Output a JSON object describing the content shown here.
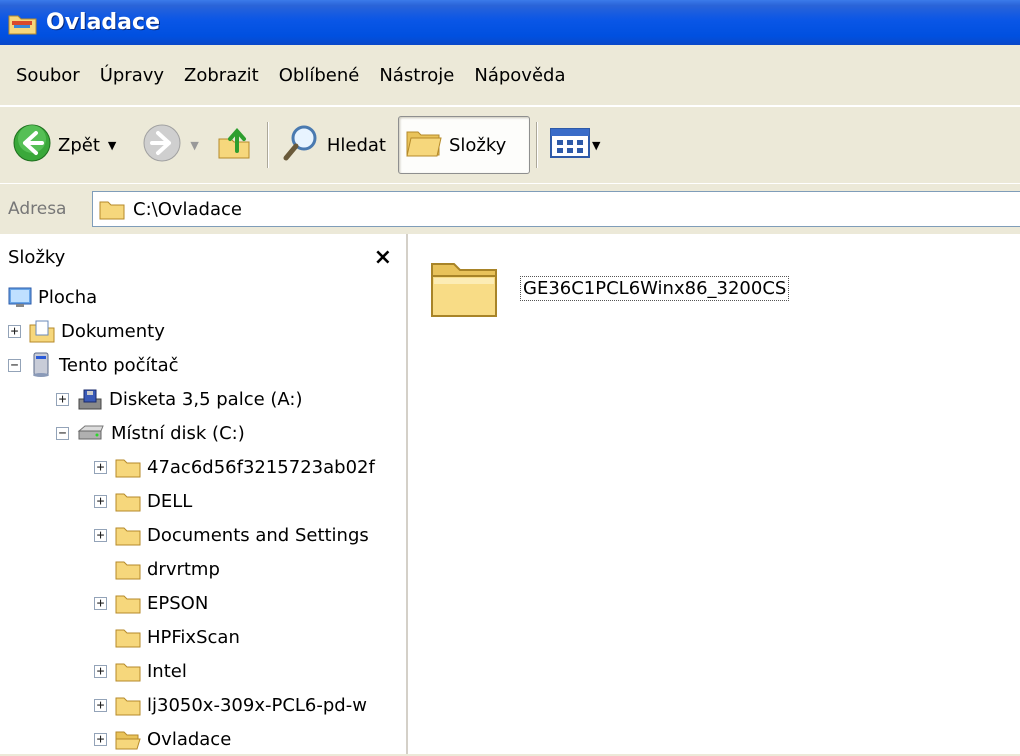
{
  "window": {
    "title": "Ovladace"
  },
  "menu": [
    "Soubor",
    "Úpravy",
    "Zobrazit",
    "Oblíbené",
    "Nástroje",
    "Nápověda"
  ],
  "toolbar": {
    "back_label": "Zpět",
    "search_label": "Hledat",
    "folders_label": "Složky"
  },
  "address": {
    "label": "Adresa",
    "value": "C:\\Ovladace"
  },
  "folder_pane": {
    "title": "Složky",
    "close_glyph": "×",
    "tree": [
      {
        "label": "Plocha",
        "level": 0,
        "expander": "",
        "icon": "desktop-icon"
      },
      {
        "label": "Dokumenty",
        "level": 1,
        "expander": "+",
        "icon": "documents-folder-icon"
      },
      {
        "label": "Tento počítač",
        "level": 1,
        "expander": "−",
        "icon": "computer-icon"
      },
      {
        "label": "Disketa 3,5 palce (A:)",
        "level": 2,
        "expander": "+",
        "icon": "floppy-icon"
      },
      {
        "label": "Místní disk (C:)",
        "level": 2,
        "expander": "−",
        "icon": "drive-icon"
      },
      {
        "label": "47ac6d56f3215723ab02f",
        "level": 3,
        "expander": "+",
        "icon": "folder-icon"
      },
      {
        "label": "DELL",
        "level": 3,
        "expander": "+",
        "icon": "folder-icon"
      },
      {
        "label": "Documents and Settings",
        "level": 3,
        "expander": "+",
        "icon": "folder-icon"
      },
      {
        "label": "drvrtmp",
        "level": 3,
        "expander": "",
        "icon": "folder-icon"
      },
      {
        "label": "EPSON",
        "level": 3,
        "expander": "+",
        "icon": "folder-icon"
      },
      {
        "label": "HPFixScan",
        "level": 3,
        "expander": "",
        "icon": "folder-icon"
      },
      {
        "label": "Intel",
        "level": 3,
        "expander": "+",
        "icon": "folder-icon"
      },
      {
        "label": "lj3050x-309x-PCL6-pd-w",
        "level": 3,
        "expander": "+",
        "icon": "folder-icon"
      },
      {
        "label": "Ovladace",
        "level": 3,
        "expander": "+",
        "icon": "open-folder-icon"
      }
    ]
  },
  "content": {
    "items": [
      {
        "label": "GE36C1PCL6Winx86_3200CS",
        "icon": "folder-icon"
      }
    ]
  },
  "colors": {
    "titlebar": "#0a56e6",
    "chrome": "#ece9d8",
    "folder": "#f6d77c"
  }
}
